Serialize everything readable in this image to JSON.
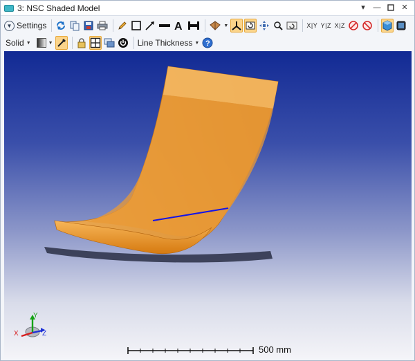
{
  "window": {
    "title": "3: NSC Shaded Model",
    "controls": [
      "chevron-down-icon",
      "minimize-icon",
      "maximize-icon",
      "close-icon"
    ]
  },
  "toolbar1": {
    "settings_label": "Settings",
    "axis_buttons": [
      "X|Y",
      "Y|Z",
      "X|Z"
    ]
  },
  "toolbar2": {
    "render_mode": "Solid",
    "line_thickness_label": "Line Thickness"
  },
  "viewport": {
    "scale_bar_label": "500 mm",
    "axis_triad": {
      "x": "X",
      "y": "Y",
      "z": "Z"
    },
    "colors": {
      "background_top": "#122a94",
      "background_bottom": "#f4f4f8",
      "surface": "#f0a23c",
      "ray": "#1a1aff"
    }
  }
}
